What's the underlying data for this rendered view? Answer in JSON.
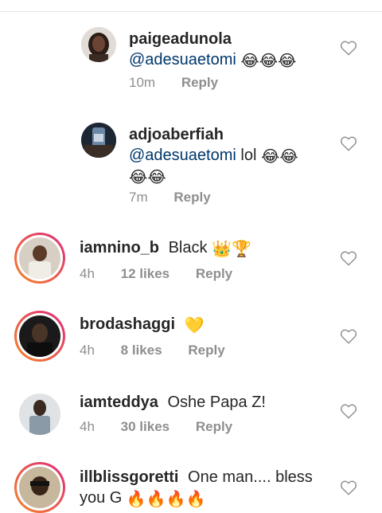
{
  "replies": [
    {
      "username": "paigeadunola",
      "mention": "@adesuaetomi",
      "text": "",
      "emoji_line1": "😂😂😂",
      "emoji_line2": "",
      "time": "10m",
      "reply_label": "Reply"
    },
    {
      "username": "adjoaberfiah",
      "mention": "@adesuaetomi",
      "text": "lol",
      "emoji_line1": "😂😂",
      "emoji_line2": "😂😂",
      "time": "7m",
      "reply_label": "Reply"
    }
  ],
  "comments": [
    {
      "username": "iamnino_b",
      "text": "Black",
      "emoji": "👑🏆",
      "time": "4h",
      "likes": "12 likes",
      "reply_label": "Reply"
    },
    {
      "username": "brodashaggi",
      "text": "",
      "emoji": "💛",
      "time": "4h",
      "likes": "8 likes",
      "reply_label": "Reply"
    },
    {
      "username": "iamteddya",
      "text": "Oshe Papa Z!",
      "emoji": "",
      "time": "4h",
      "likes": "30 likes",
      "reply_label": "Reply"
    },
    {
      "username": "illblissgoretti",
      "text": "One man.... bless",
      "text_line2": "you G",
      "emoji": "🔥🔥🔥🔥",
      "time": "",
      "likes": "",
      "reply_label": ""
    }
  ],
  "colors": {
    "story_ring_start": "#f58529",
    "story_ring_end": "#dd2a7b",
    "mention": "#00376b",
    "meta": "#8e8e8e"
  }
}
